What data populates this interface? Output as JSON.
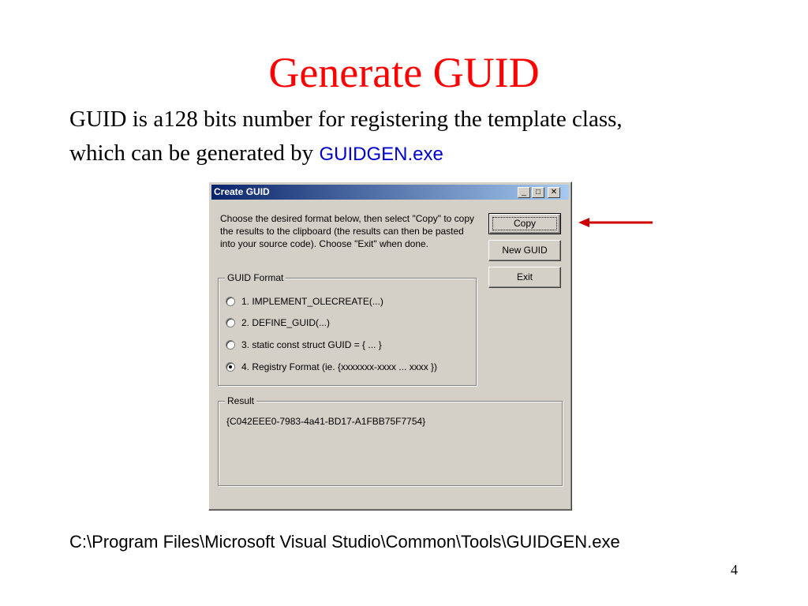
{
  "slide": {
    "title": "Generate GUID",
    "intro_line1": "GUID is a128 bits number for registering the template class,",
    "intro_line2": "which can be generated by ",
    "intro_program": "GUIDGEN.exe",
    "path": "C:\\Program Files\\Microsoft Visual Studio\\Common\\Tools\\GUIDGEN.exe",
    "page_number": "4"
  },
  "window": {
    "title": "Create GUID",
    "minimize_glyph": "_",
    "maximize_glyph": "□",
    "close_glyph": "✕",
    "description": "Choose the desired format below, then select \"Copy\" to copy the results to the clipboard (the results can then be pasted into your source code).  Choose \"Exit\" when done.",
    "buttons": {
      "copy": "Copy",
      "new_guid": "New GUID",
      "exit": "Exit"
    },
    "guid_format": {
      "label": "GUID Format",
      "options": [
        "1. IMPLEMENT_OLECREATE(...)",
        "2. DEFINE_GUID(...)",
        "3. static const struct GUID = { ... }",
        "4. Registry Format (ie. {xxxxxxx-xxxx ... xxxx })"
      ],
      "selected_index": 3
    },
    "result": {
      "label": "Result",
      "value": "{C042EEE0-7983-4a41-BD17-A1FBB75F7754}"
    }
  },
  "colors": {
    "title": "#ff0000",
    "program_link": "#0000cc",
    "arrow": "#cc0000",
    "titlebar_start": "#0a246a",
    "titlebar_end": "#a6caf0",
    "dialog_face": "#d4d0c8"
  },
  "icons": [
    "minimize-icon",
    "maximize-icon",
    "close-icon",
    "left-arrow-icon"
  ]
}
